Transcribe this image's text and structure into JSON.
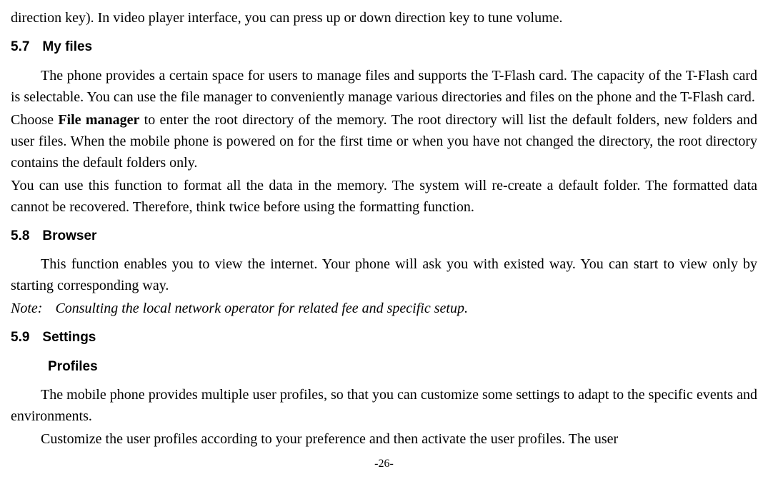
{
  "top_fragment": "direction key). In video player interface, you can press up or down direction key to tune volume.",
  "sec57": {
    "num": "5.7",
    "title": "My files",
    "p1_a": "The phone provides a certain space for users to manage files and supports the T-Flash card. The capacity of the T-Flash card is selectable. You can use the file manager to conveniently manage various directories and files on the phone and the T-Flash card.",
    "p2_a": "Choose ",
    "p2_b": "File manager",
    "p2_c": " to enter the root directory of the memory. The root directory will list the default folders, new folders and user files. When the mobile phone is powered on for the first time or when you have not changed the directory, the root directory contains the default folders only.",
    "p3": "You can use this function to format all the data in the memory. The system will re-create a default folder. The formatted data cannot be recovered. Therefore, think twice before using the formatting function."
  },
  "sec58": {
    "num": "5.8",
    "title": "Browser",
    "p1": "This function enables you to view the internet. Your phone will ask you with existed way. You can start to view only by starting corresponding way.",
    "note_label": "Note:",
    "note_text": "Consulting the local network operator for related fee and specific setup."
  },
  "sec59": {
    "num": "5.9",
    "title": "Settings",
    "sub1": "Profiles",
    "p1": "The mobile phone provides multiple user profiles, so that you can customize some settings to adapt to the specific events and environments.",
    "p2": "Customize the user profiles according to your preference and then activate the user profiles. The user"
  },
  "page_num": "-26-"
}
